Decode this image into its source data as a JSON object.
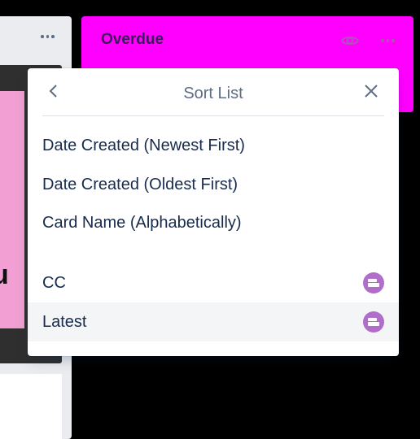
{
  "left_list": {
    "menu_icon": "more-horizontal-icon",
    "card_text_fragment": "u\n-"
  },
  "overdue_list": {
    "title": "Overdue",
    "watch_icon": "eye-icon",
    "menu_icon": "more-horizontal-icon",
    "color": "#ff00ff"
  },
  "sort_popover": {
    "title": "Sort List",
    "back_icon": "chevron-left-icon",
    "close_icon": "close-icon",
    "options": [
      {
        "label": "Date Created (Newest First)"
      },
      {
        "label": "Date Created (Oldest First)"
      },
      {
        "label": "Card Name (Alphabetically)"
      }
    ],
    "custom_fields": [
      {
        "label": "CC",
        "icon": "custom-field-icon"
      },
      {
        "label": "Latest",
        "icon": "custom-field-icon",
        "hovered": true
      }
    ],
    "accent_color": "#b06dc9"
  }
}
